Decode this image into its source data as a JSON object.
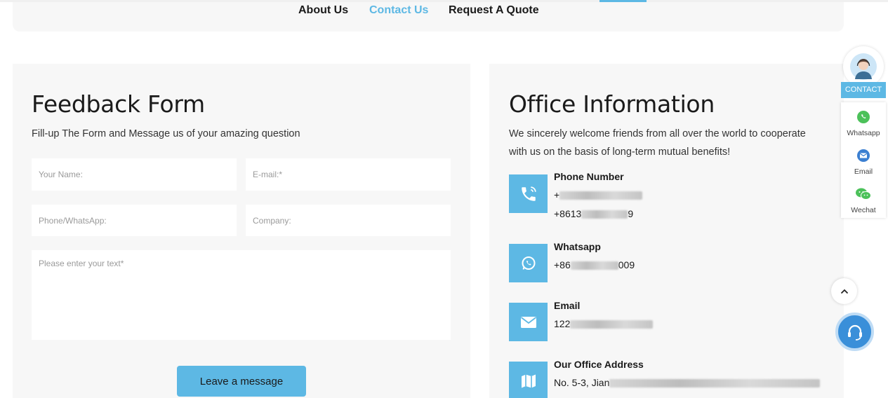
{
  "nav": {
    "items": [
      {
        "label": "About Us",
        "active": false
      },
      {
        "label": "Contact Us",
        "active": true
      },
      {
        "label": "Request A Quote",
        "active": false
      }
    ]
  },
  "feedback": {
    "title": "Feedback Form",
    "subtitle": "Fill-up The Form and Message us of your amazing question",
    "name_placeholder": "Your Name:",
    "email_placeholder": "E-mail:*",
    "phone_placeholder": "Phone/WhatsApp:",
    "company_placeholder": "Company:",
    "message_placeholder": "Please enter your text*",
    "submit_label": "Leave a message"
  },
  "office": {
    "title": "Office Information",
    "intro": "We sincerely welcome friends from all over the world to cooperate with us on the basis of long-term mutual benefits!",
    "phone": {
      "label": "Phone Number",
      "line1_prefix": "+",
      "line2_prefix": "+8613",
      "line2_suffix": "9"
    },
    "whatsapp": {
      "label": "Whatsapp",
      "prefix": "+86",
      "suffix": "009"
    },
    "email": {
      "label": "Email",
      "prefix": "122"
    },
    "address": {
      "label": "Our Office Address",
      "prefix": "No. 5-3, Jian"
    }
  },
  "side_widget": {
    "contact_label": "CONTACT",
    "whatsapp_label": "Whatsapp",
    "email_label": "Email",
    "wechat_label": "Wechat"
  },
  "colors": {
    "accent": "#5db8e4",
    "support": "#3a8fd9",
    "panel": "#f7f7f7"
  }
}
